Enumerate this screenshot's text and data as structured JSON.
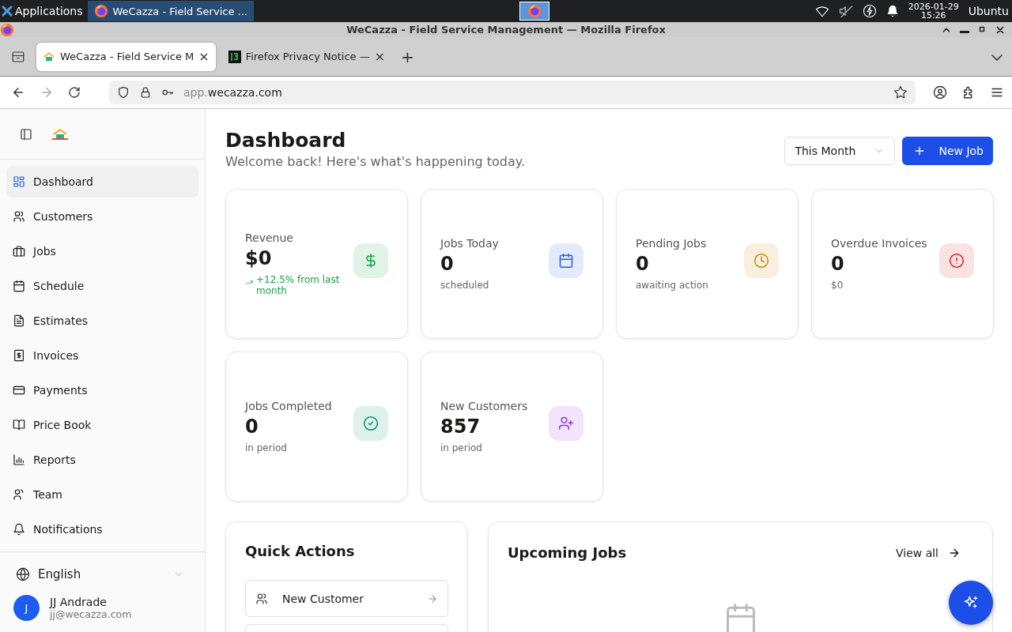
{
  "taskbar": {
    "apps_label": "Applications",
    "window_button": "WeCazza - Field Service ...",
    "date": "2026-01-29",
    "time": "15:26",
    "user": "Ubuntu"
  },
  "window": {
    "title": "WeCazza - Field Service Management — Mozilla Firefox"
  },
  "tabs": [
    {
      "label": "WeCazza - Field Service M",
      "close": "×",
      "selected": true
    },
    {
      "label": "Firefox Privacy Notice —",
      "close": "×",
      "selected": false
    }
  ],
  "new_tab": "+",
  "address": {
    "subdomain": "app.",
    "domain": "wecazza.com"
  },
  "sidebar": {
    "items": [
      {
        "label": "Dashboard",
        "selected": true
      },
      {
        "label": "Customers",
        "selected": false
      },
      {
        "label": "Jobs",
        "selected": false
      },
      {
        "label": "Schedule",
        "selected": false
      },
      {
        "label": "Estimates",
        "selected": false
      },
      {
        "label": "Invoices",
        "selected": false
      },
      {
        "label": "Payments",
        "selected": false
      },
      {
        "label": "Price Book",
        "selected": false
      },
      {
        "label": "Reports",
        "selected": false
      },
      {
        "label": "Team",
        "selected": false
      },
      {
        "label": "Notifications",
        "selected": false
      }
    ],
    "language": "English",
    "user": {
      "initial": "J",
      "name": "JJ Andrade",
      "email": "jj@wecazza.com"
    }
  },
  "header": {
    "title": "Dashboard",
    "subtitle": "Welcome back! Here's what's happening today.",
    "period": "This Month",
    "new_job": "New Job"
  },
  "stats": [
    {
      "label": "Revenue",
      "value": "$0",
      "trend": "+12.5% from last month",
      "color": "#16a34a"
    },
    {
      "label": "Jobs Today",
      "value": "0",
      "note": "scheduled",
      "color": "#2563eb"
    },
    {
      "label": "Pending Jobs",
      "value": "0",
      "note": "awaiting action",
      "color": "#ca8a04"
    },
    {
      "label": "Overdue Invoices",
      "value": "0",
      "note": "$0",
      "color": "#dc2626"
    },
    {
      "label": "Jobs Completed",
      "value": "0",
      "note": "in period",
      "color": "#059669"
    },
    {
      "label": "New Customers",
      "value": "857",
      "note": "in period",
      "color": "#9333ea"
    }
  ],
  "quick_actions": {
    "title": "Quick Actions",
    "items": [
      {
        "label": "New Customer"
      }
    ]
  },
  "upcoming_jobs": {
    "title": "Upcoming Jobs",
    "view_all": "View all"
  }
}
